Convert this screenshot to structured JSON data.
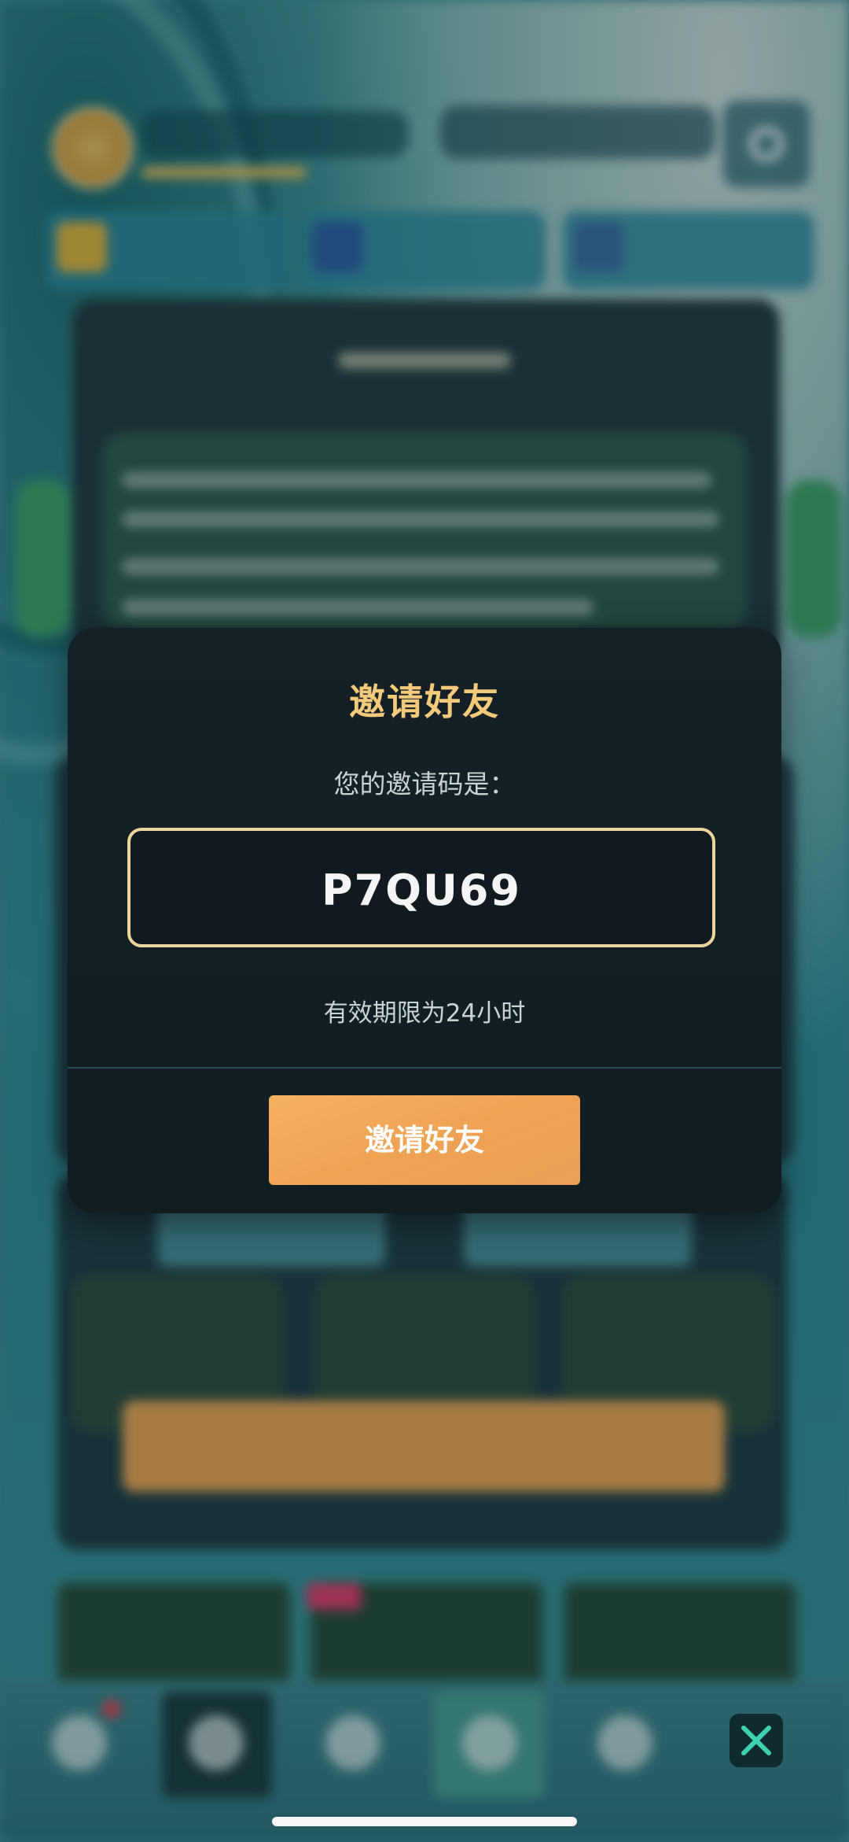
{
  "invite_dialog": {
    "title": "邀请好友",
    "code_caption": "您的邀请码是：",
    "invite_code": "P7QU69",
    "validity_text": "有效期限为24小时",
    "invite_button_label": "邀请好友"
  },
  "colors": {
    "dialog_bg": "#142127",
    "title_gold": "#f3c97c",
    "code_border": "#ecd59a",
    "button_orange": "#f0a855"
  },
  "icons": {
    "close": "close-icon",
    "settings": "gear-icon"
  }
}
